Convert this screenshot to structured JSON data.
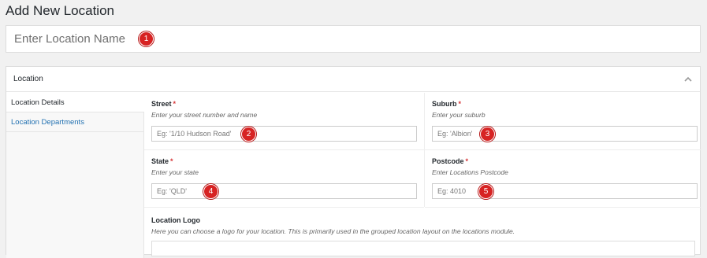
{
  "page": {
    "title": "Add New Location"
  },
  "title_field": {
    "placeholder": "Enter Location Name",
    "badge": "1"
  },
  "postbox": {
    "title": "Location",
    "toggle_icon": "chevron-up-icon"
  },
  "tabs": [
    {
      "label": "Location Details",
      "active": true
    },
    {
      "label": "Location Departments",
      "active": false
    }
  ],
  "fields": {
    "street": {
      "label": "Street",
      "required": "*",
      "description": "Enter your street number and name",
      "placeholder": "Eg: '1/10 Hudson Road'",
      "badge": "2"
    },
    "suburb": {
      "label": "Suburb",
      "required": "*",
      "description": "Enter your suburb",
      "placeholder": "Eg: 'Albion'",
      "badge": "3"
    },
    "state": {
      "label": "State",
      "required": "*",
      "description": "Enter your state",
      "placeholder": "Eg: 'QLD'",
      "badge": "4"
    },
    "postcode": {
      "label": "Postcode",
      "required": "*",
      "description": "Enter Locations Postcode",
      "placeholder": "Eg: 4010",
      "badge": "5"
    },
    "logo": {
      "label": "Location Logo",
      "description": "Here you can choose a logo for your location. This is primarily used in the grouped location layout on the locations module."
    }
  },
  "colors": {
    "badge": "#d72323",
    "link": "#2271b1",
    "required": "#d63638"
  }
}
